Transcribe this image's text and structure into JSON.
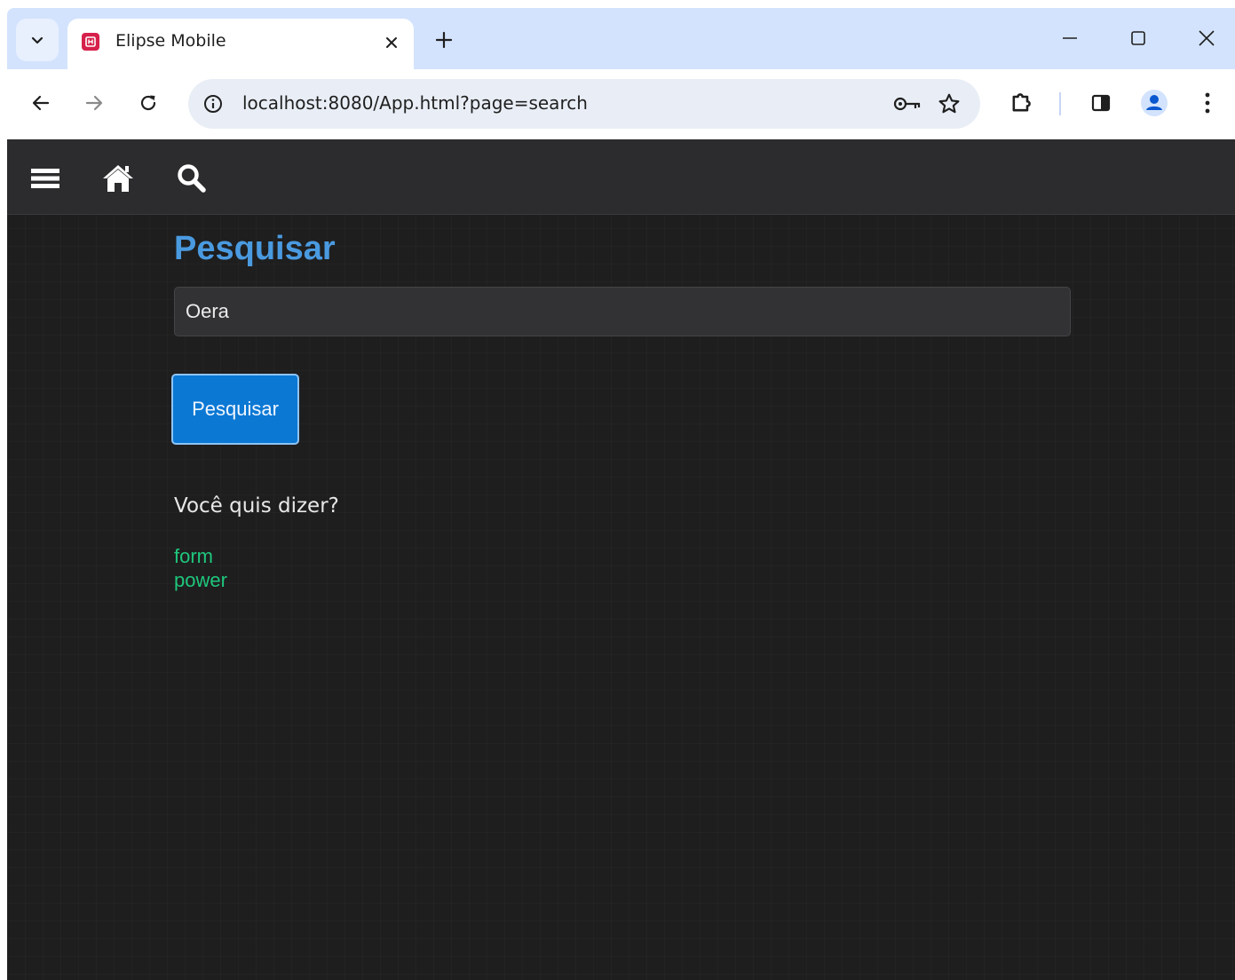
{
  "browser": {
    "tab": {
      "title": "Elipse Mobile"
    },
    "address_bar": {
      "url": "localhost:8080/App.html?page=search"
    }
  },
  "icons": {
    "tab_search": "chevron-down-icon",
    "favicon": "elipse-favicon",
    "tab_close": "close-icon",
    "new_tab": "plus-icon",
    "minimize": "minimize-icon",
    "maximize": "maximize-icon",
    "close_window": "close-icon",
    "back": "arrow-left-icon",
    "forward": "arrow-right-icon",
    "reload": "reload-icon",
    "site_info": "info-icon",
    "password": "key-icon",
    "bookmark": "star-icon",
    "extensions": "puzzle-icon",
    "side_panel": "side-panel-icon",
    "profile": "profile-icon",
    "menu": "kebab-menu-icon",
    "app_menu": "hamburger-icon",
    "app_home": "home-icon",
    "app_search": "search-icon"
  },
  "colors": {
    "title": "#4a9ae0",
    "button": "#0b78d4",
    "suggestion": "#1fc77c",
    "background": "#1e1e1f",
    "navbar": "#2c2c2e"
  },
  "page": {
    "title": "Pesquisar",
    "search": {
      "value": "Oera"
    },
    "search_button": "Pesquisar",
    "suggestions_label": "Você quis dizer?",
    "suggestions": [
      "form",
      "power"
    ]
  }
}
